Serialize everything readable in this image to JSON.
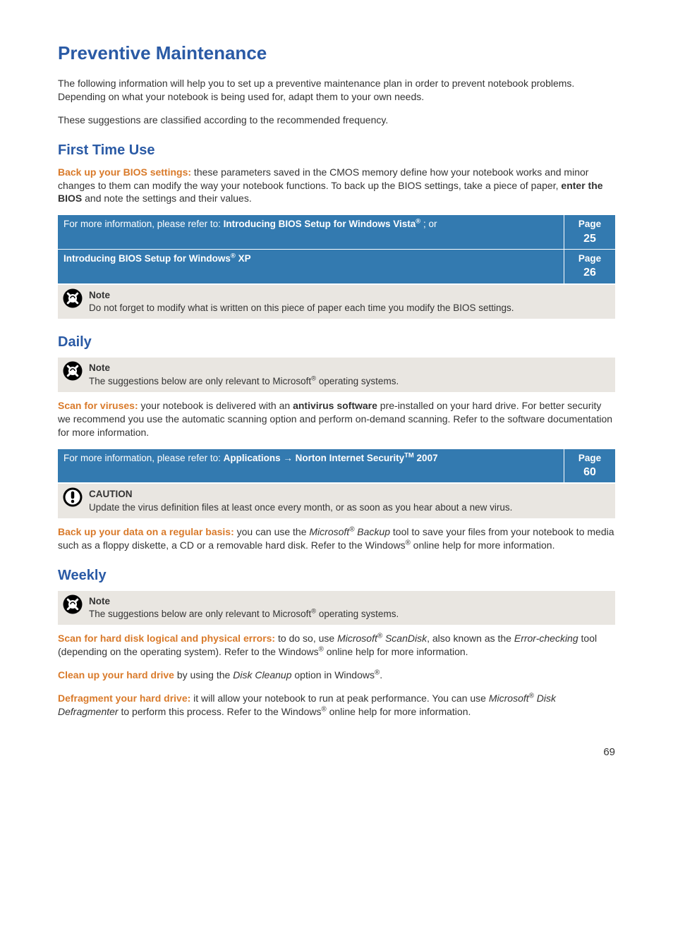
{
  "title": "Preventive Maintenance",
  "intro1": "The following information will help you to set up a preventive maintenance plan in order to prevent notebook problems. Depending on what your notebook is being used for, adapt them to your own needs.",
  "intro2": "These suggestions are classified according to the recommended frequency.",
  "first_time": {
    "heading": "First Time Use",
    "backup_lead": "Back up your BIOS settings:",
    "backup_text_a": " these parameters saved in the CMOS memory define how your notebook works and minor changes to them can modify the way your notebook functions. To back up the BIOS settings, take a piece of paper, ",
    "backup_bold": "enter the BIOS",
    "backup_text_b": " and note the settings and their values.",
    "ref1_prefix": "For more information, please refer to: ",
    "ref1_bold": "Introducing BIOS Setup for Windows Vista",
    "ref1_suffix": " ; or",
    "ref1_page_label": "Page",
    "ref1_page_num": "25",
    "ref2_bold": "Introducing BIOS Setup for Windows",
    "ref2_tail": " XP",
    "ref2_page_label": "Page",
    "ref2_page_num": "26",
    "note_hdr": "Note",
    "note_body": "Do not forget to modify what is written on this piece of paper each time you modify the BIOS settings."
  },
  "daily": {
    "heading": "Daily",
    "note_hdr": "Note",
    "note_body_a": "The suggestions below are only relevant to Microsoft",
    "note_body_b": " operating systems.",
    "scan_lead": "Scan for viruses:",
    "scan_text_a": " your notebook is delivered with an ",
    "scan_bold": "antivirus software",
    "scan_text_b": " pre-installed on your hard drive. For better security we recommend you use the automatic scanning option and perform on-demand scanning. Refer to the software documentation for more information.",
    "ref_prefix": "For more information, please refer to: ",
    "ref_bold_a": "Applications",
    "ref_arrow": " → ",
    "ref_bold_b": "Norton Internet Security",
    "ref_bold_c": " 2007",
    "ref_page_label": "Page",
    "ref_page_num": "60",
    "caution_hdr": "CAUTION",
    "caution_body": "Update the virus definition files at least once every month, or as soon as you hear about a new virus.",
    "backup_lead": "Back up your data on a regular basis:",
    "backup_text_a": " you can use the ",
    "backup_italic": "Microsoft",
    "backup_italic_b": " Backup",
    "backup_text_b": " tool to save your files from your notebook to media such as a floppy diskette, a CD or a removable hard disk. Refer to the Windows",
    "backup_text_c": " online help for more information."
  },
  "weekly": {
    "heading": "Weekly",
    "note_hdr": "Note",
    "note_body_a": "The suggestions below are only relevant to Microsoft",
    "note_body_b": " operating systems.",
    "scan_lead": "Scan for hard disk logical and physical errors:",
    "scan_text_a": " to do so, use ",
    "scan_italic_a": "Microsoft",
    "scan_italic_b": " ScanDisk",
    "scan_text_b": ", also known as the ",
    "scan_italic_c": "Error-checking",
    "scan_text_c": " tool (depending on the operating system). Refer to the Windows",
    "scan_text_d": " online help for more information.",
    "clean_lead": "Clean up your hard drive",
    "clean_text_a": " by using the ",
    "clean_italic": "Disk Cleanup",
    "clean_text_b": " option in Windows",
    "clean_text_c": ".",
    "defrag_lead": "Defragment your hard drive:",
    "defrag_text_a": " it will allow your notebook to run at peak performance. You can use ",
    "defrag_italic_a": "Microsoft",
    "defrag_italic_b": " Disk Defragmenter",
    "defrag_text_b": " to perform this process. Refer to the Windows",
    "defrag_text_c": " online help for more information."
  },
  "page_number": "69"
}
